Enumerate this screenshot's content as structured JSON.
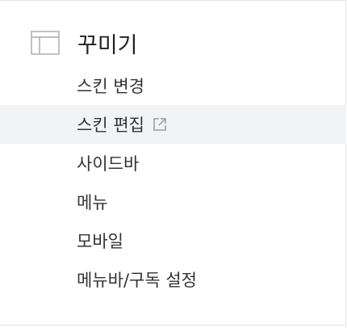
{
  "section": {
    "title": "꾸미기",
    "icon": "layout-icon"
  },
  "menu": {
    "items": [
      {
        "label": "스킨 변경"
      },
      {
        "label": "스킨 편집",
        "external_icon": "external-link-icon",
        "active": true
      },
      {
        "label": "사이드바"
      },
      {
        "label": "메뉴"
      },
      {
        "label": "모바일"
      },
      {
        "label": "메뉴바/구독 설정"
      }
    ]
  },
  "colors": {
    "text": "#333333",
    "title": "#222222",
    "active_bg": "#f2f3f7",
    "icon": "#999999",
    "divider": "#e6e6ea"
  }
}
